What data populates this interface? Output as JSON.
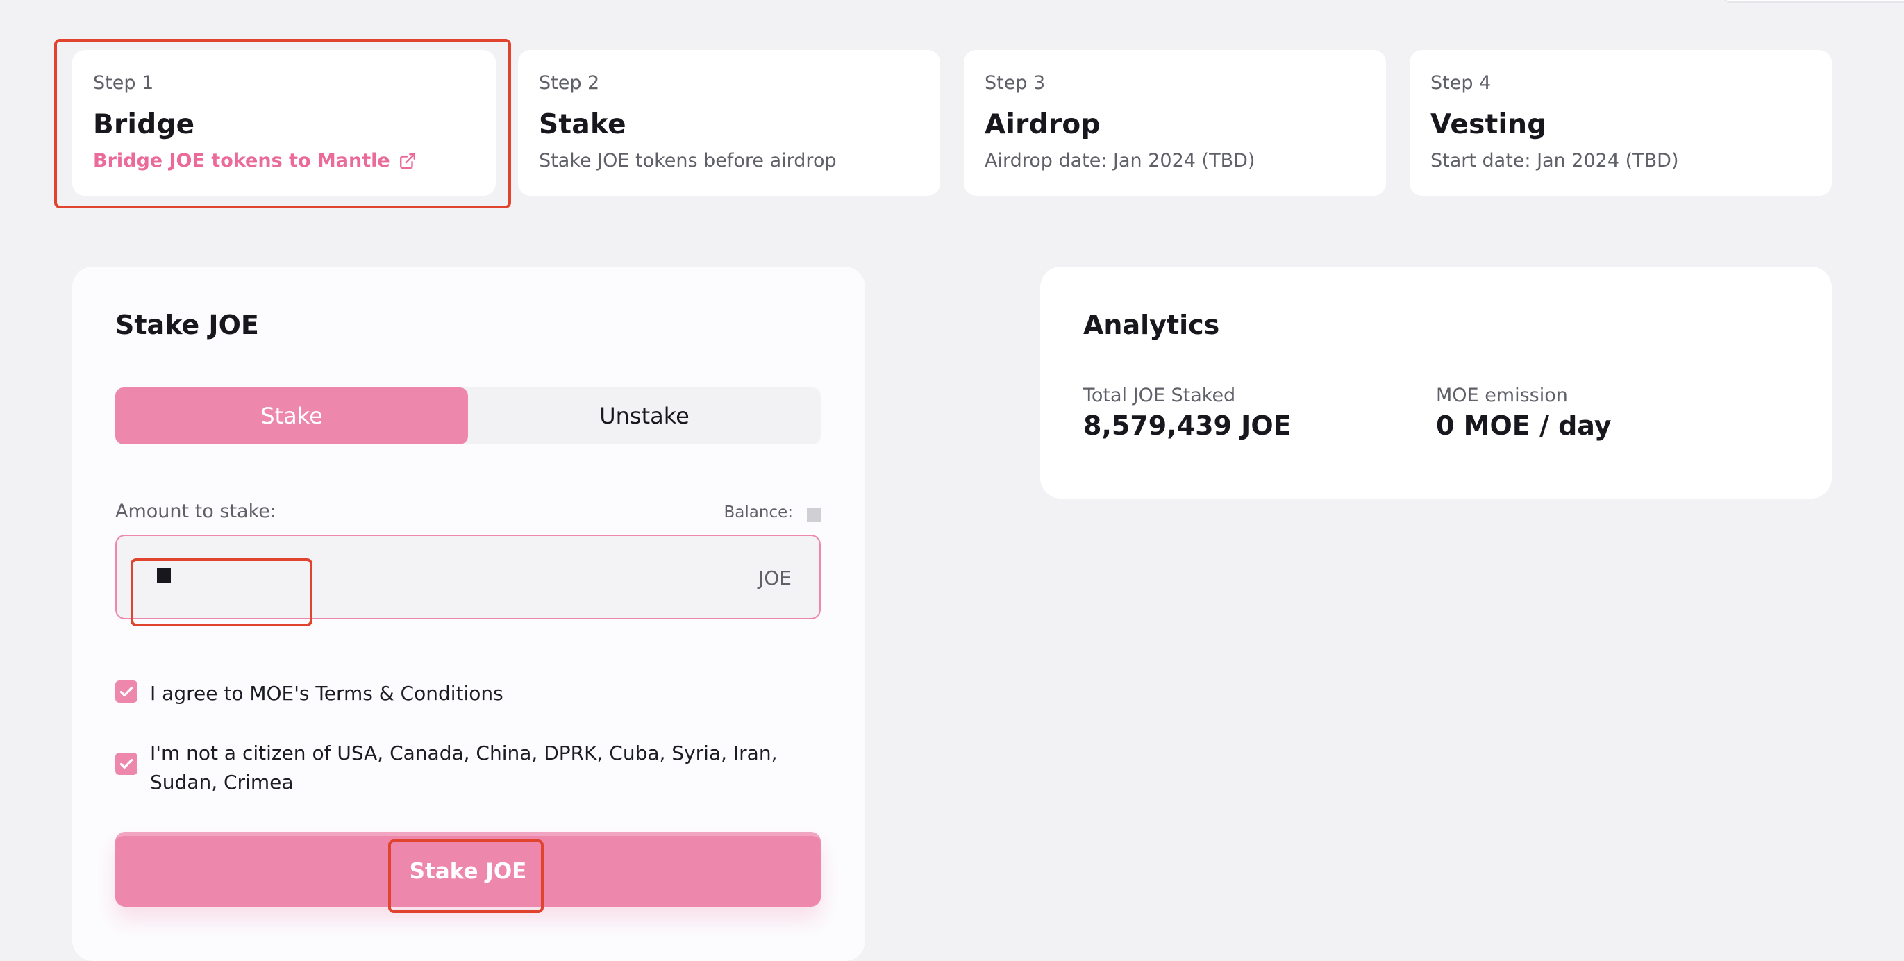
{
  "steps": [
    {
      "num": "Step 1",
      "title": "Bridge",
      "desc": "Bridge JOE tokens to Mantle",
      "desc_is_link": true
    },
    {
      "num": "Step 2",
      "title": "Stake",
      "desc": "Stake JOE tokens before airdrop"
    },
    {
      "num": "Step 3",
      "title": "Airdrop",
      "desc": "Airdrop date: Jan 2024 (TBD)"
    },
    {
      "num": "Step 4",
      "title": "Vesting",
      "desc": "Start date: Jan 2024 (TBD)"
    }
  ],
  "stake_panel": {
    "title": "Stake JOE",
    "tabs": {
      "stake": "Stake",
      "unstake": "Unstake"
    },
    "active_tab": "stake",
    "amount_label": "Amount to stake:",
    "balance_label": "Balance:",
    "input": {
      "value": "",
      "unit": "JOE"
    },
    "checkboxes": [
      {
        "label": "I agree to MOE's Terms & Conditions",
        "checked": true
      },
      {
        "label": "I'm not a citizen of USA, Canada, China, DPRK, Cuba, Syria, Iran, Sudan, Crimea",
        "checked": true
      }
    ],
    "submit_label": "Stake JOE"
  },
  "analytics": {
    "title": "Analytics",
    "metrics": [
      {
        "label": "Total JOE Staked",
        "value": "8,579,439 JOE"
      },
      {
        "label": "MOE emission",
        "value": "0 MOE / day"
      }
    ]
  },
  "colors": {
    "accent": "#ee87ac",
    "link": "#ea6a99",
    "highlight": "#e0442e",
    "background": "#f2f2f5"
  },
  "icons": {
    "external_link": "external-link-icon",
    "checkmark": "checkmark-icon"
  }
}
